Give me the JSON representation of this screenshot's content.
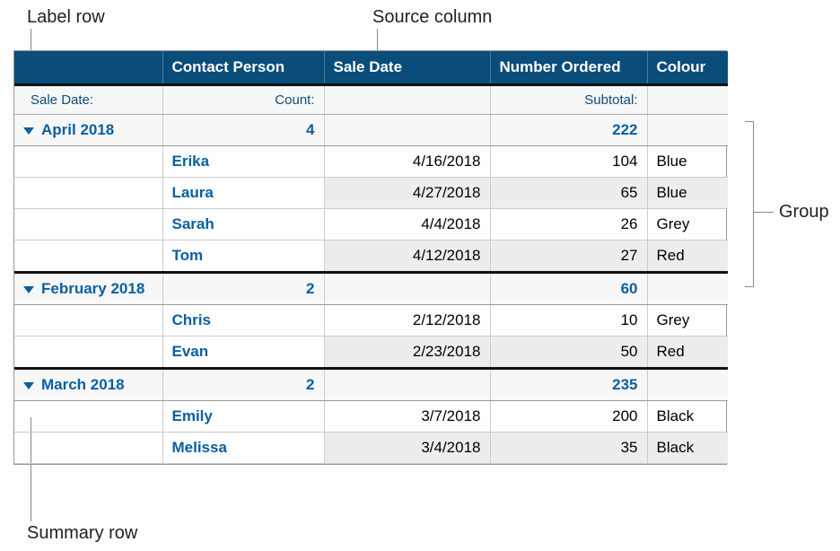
{
  "callouts": {
    "label_row": "Label row",
    "source_column": "Source column",
    "group": "Group",
    "summary_row": "Summary row"
  },
  "headers": {
    "c1": "",
    "c2": "Contact Person",
    "c3": "Sale Date",
    "c4": "Number Ordered",
    "c5": "Colour"
  },
  "label_row": {
    "sale_date": "Sale Date:",
    "count": "Count:",
    "subtotal": "Subtotal:"
  },
  "groups": [
    {
      "name": "April 2018",
      "count": 4,
      "subtotal": 222,
      "rows": [
        {
          "contact": "Erika",
          "date": "4/16/2018",
          "num": 104,
          "colour": "Blue"
        },
        {
          "contact": "Laura",
          "date": "4/27/2018",
          "num": 65,
          "colour": "Blue"
        },
        {
          "contact": "Sarah",
          "date": "4/4/2018",
          "num": 26,
          "colour": "Grey"
        },
        {
          "contact": "Tom",
          "date": "4/12/2018",
          "num": 27,
          "colour": "Red"
        }
      ]
    },
    {
      "name": "February 2018",
      "count": 2,
      "subtotal": 60,
      "rows": [
        {
          "contact": "Chris",
          "date": "2/12/2018",
          "num": 10,
          "colour": "Grey"
        },
        {
          "contact": "Evan",
          "date": "2/23/2018",
          "num": 50,
          "colour": "Red"
        }
      ]
    },
    {
      "name": "March 2018",
      "count": 2,
      "subtotal": 235,
      "rows": [
        {
          "contact": "Emily",
          "date": "3/7/2018",
          "num": 200,
          "colour": "Black"
        },
        {
          "contact": "Melissa",
          "date": "3/4/2018",
          "num": 35,
          "colour": "Black"
        }
      ]
    }
  ]
}
